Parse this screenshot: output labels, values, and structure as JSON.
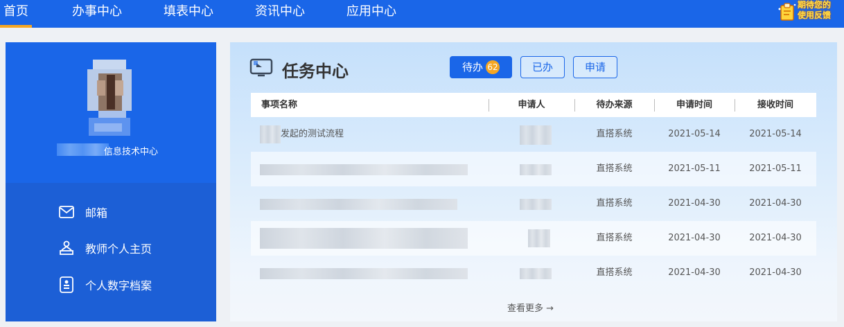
{
  "nav": {
    "items": [
      {
        "label": "首页",
        "active": true
      },
      {
        "label": "办事中心"
      },
      {
        "label": "填表中心"
      },
      {
        "label": "资讯中心"
      },
      {
        "label": "应用中心"
      }
    ],
    "feedback": {
      "line1": "期待您的",
      "line2": "使用反馈"
    }
  },
  "profile": {
    "department": "信息技术中心"
  },
  "menu": [
    {
      "label": "邮箱",
      "icon": "mail-icon"
    },
    {
      "label": "教师个人主页",
      "icon": "teacher-home-icon"
    },
    {
      "label": "个人数字档案",
      "icon": "digital-archive-icon"
    }
  ],
  "task": {
    "title": "任务中心",
    "tabs": {
      "todo": "待办",
      "todo_count": "62",
      "done": "已办",
      "apply": "申请"
    },
    "columns": [
      "事项名称",
      "申请人",
      "待办来源",
      "申请时间",
      "接收时间"
    ],
    "rows": [
      {
        "name": "发起的测试流程",
        "applicant": "",
        "source": "直搭系统",
        "apply_time": "2021-05-14",
        "receive_time": "2021-05-14"
      },
      {
        "name": "",
        "applicant": "",
        "source": "直搭系统",
        "apply_time": "2021-05-11",
        "receive_time": "2021-05-11"
      },
      {
        "name": "",
        "applicant": "",
        "source": "直搭系统",
        "apply_time": "2021-04-30",
        "receive_time": "2021-04-30"
      },
      {
        "name": "",
        "applicant": "",
        "source": "直搭系统",
        "apply_time": "2021-04-30",
        "receive_time": "2021-04-30"
      },
      {
        "name": "",
        "applicant": "",
        "source": "直搭系统",
        "apply_time": "2021-04-30",
        "receive_time": "2021-04-30"
      }
    ],
    "more": "查看更多 →"
  },
  "colors": {
    "primary": "#1a66e8",
    "accent": "#f5a623",
    "menu_bg": "#1c5fd6"
  }
}
